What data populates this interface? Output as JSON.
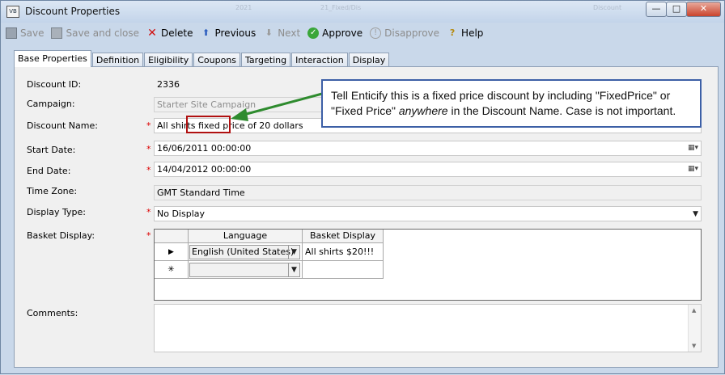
{
  "window": {
    "title": "Discount Properties",
    "app_icon_label": "VB",
    "ghost_tabs": [
      "2021",
      "21_Fixed/Dis",
      "Discount"
    ],
    "min_glyph": "—",
    "max_glyph": "□",
    "close_glyph": "✕"
  },
  "toolbar": {
    "save": "Save",
    "save_close": "Save and close",
    "delete": "Delete",
    "previous": "Previous",
    "next": "Next",
    "approve": "Approve",
    "disapprove": "Disapprove",
    "help": "Help"
  },
  "tabs": [
    "Base Properties",
    "Definition",
    "Eligibility",
    "Coupons",
    "Targeting",
    "Interaction",
    "Display"
  ],
  "form": {
    "discount_id_label": "Discount ID:",
    "discount_id": "2336",
    "campaign_label": "Campaign:",
    "campaign": "Starter Site Campaign",
    "discount_name_label": "Discount Name:",
    "discount_name": "All shirts fixed price of 20 dollars",
    "start_date_label": "Start Date:",
    "start_date": "16/06/2011 00:00:00",
    "end_date_label": "End Date:",
    "end_date": "14/04/2012 00:00:00",
    "time_zone_label": "Time Zone:",
    "time_zone": "GMT Standard Time",
    "display_type_label": "Display Type:",
    "display_type": "No Display",
    "basket_display_label": "Basket Display:",
    "comments_label": "Comments:",
    "required_mark": "*"
  },
  "basket_grid": {
    "headers": [
      "Language",
      "Basket Display"
    ],
    "rows": [
      {
        "indicator": "▶",
        "language": "English (United States)",
        "basket_display": "All shirts $20!!!"
      },
      {
        "indicator": "✳",
        "language": "",
        "basket_display": ""
      }
    ]
  },
  "callout": {
    "line1": "Tell Enticify this is a fixed price discount by including \"FixedPrice\" or",
    "line2_a": "\"Fixed Price\" ",
    "line2_em": "anywhere",
    "line2_b": " in the Discount Name.  Case is not important."
  },
  "colors": {
    "highlight_box": "#b01010",
    "arrow": "#2e8b2e",
    "callout_border": "#3c5fa6"
  }
}
